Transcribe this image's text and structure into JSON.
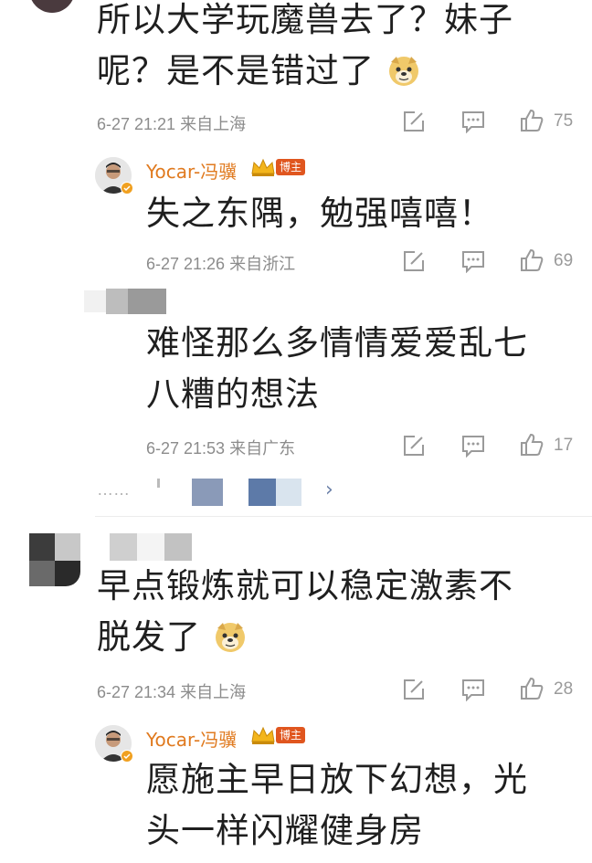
{
  "comments": [
    {
      "text_line1": "所以大学玩魔兽去了？妹子",
      "text_line2": "呢？是不是错过了",
      "meta": "6-27 21:21 来自上海",
      "likes": "75"
    },
    {
      "text_line1": "早点锻炼就可以稳定激素不",
      "text_line2": "脱发了",
      "meta": "6-27 21:34 来自上海",
      "likes": "28"
    }
  ],
  "replies": [
    {
      "username": "Yocar-冯骥",
      "badge": "博主",
      "text_line1": "失之东隅，勉强嘻嘻！",
      "meta": "6-27 21:26 来自浙江",
      "likes": "69"
    },
    {
      "text_line1": "难怪那么多情情爱爱乱七",
      "text_line2": "八糟的想法",
      "meta": "6-27 21:53 来自广东",
      "likes": "17"
    },
    {
      "username": "Yocar-冯骥",
      "badge": "博主",
      "text_line1": "愿施主早日放下幻想，光",
      "text_line2": "头一样闪耀健身房"
    }
  ],
  "more": {
    "dots": "……",
    "arrow": "›"
  },
  "colors": {
    "username": "#e07a1f",
    "badge": "#e0561f",
    "meta": "#8c8c8c",
    "divider": "#ececec"
  },
  "icons": [
    "edit-icon",
    "comment-icon",
    "like-icon",
    "doge-emoji",
    "crown-icon",
    "verified-icon"
  ]
}
